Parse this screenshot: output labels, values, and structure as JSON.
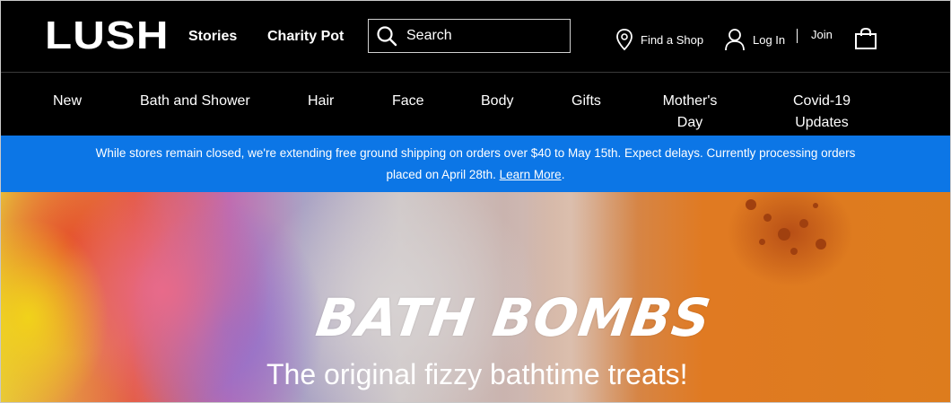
{
  "brand": {
    "logo_text": "LUSH"
  },
  "header": {
    "links": {
      "stories": "Stories",
      "charity_pot": "Charity Pot"
    },
    "search": {
      "placeholder": "Search"
    },
    "utility": {
      "find_shop": "Find a Shop",
      "login": "Log In",
      "join": "Join"
    }
  },
  "nav": {
    "items": {
      "new": "New",
      "bath_shower": "Bath and Shower",
      "hair": "Hair",
      "face": "Face",
      "body": "Body",
      "gifts": "Gifts",
      "mothers_day_line1": "Mother's",
      "mothers_day_line2": "Day",
      "covid_line1": "Covid-19",
      "covid_line2": "Updates"
    },
    "colors": {
      "mothers_day_underline": "#f0a020",
      "covid_underline": "#d0121c"
    }
  },
  "notice": {
    "text_line1": "While stores remain closed, we're extending free ground shipping on orders over $40 to May 15th. Expect delays. Currently processing orders",
    "text_line2": "placed on April 28th.",
    "link": "Learn More",
    "suffix": ".",
    "background": "#0c76e6"
  },
  "hero": {
    "title": "BATH BOMBS",
    "subtitle": "The original fizzy bathtime treats!"
  }
}
